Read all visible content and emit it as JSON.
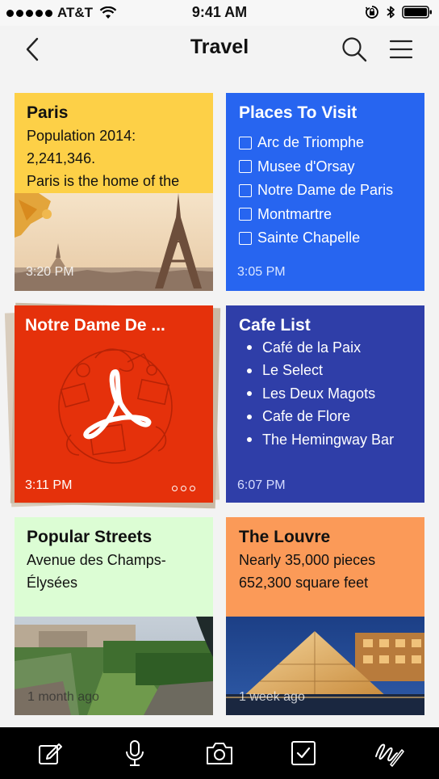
{
  "status_bar": {
    "carrier": "AT&T",
    "time": "9:41 AM",
    "icons": [
      "signal-dots",
      "wifi-icon",
      "orientation-lock-icon",
      "bluetooth-icon",
      "battery-icon"
    ]
  },
  "nav": {
    "title": "Travel",
    "back_icon": "chevron-left-icon",
    "search_icon": "search-icon",
    "menu_icon": "hamburger-menu-icon"
  },
  "cards": {
    "paris": {
      "title": "Paris",
      "body_lines": [
        "Population 2014:",
        "2,241,346.",
        "Paris is the home of the"
      ],
      "time": "3:20 PM",
      "color": "#fdd047"
    },
    "places": {
      "title": "Places To Visit",
      "items": [
        "Arc de Triomphe",
        "Musee d'Orsay",
        "Notre Dame de Paris",
        "Montmartre",
        "Sainte Chapelle"
      ],
      "time": "3:05 PM",
      "color": "#2765f0"
    },
    "notre": {
      "title": "Notre Dame De ...",
      "time": "3:11 PM",
      "icon": "pdf-icon",
      "color": "#e5310b"
    },
    "cafe": {
      "title": "Cafe List",
      "items": [
        "Café de la Paix",
        "Le Select",
        "Les Deux Magots",
        "Cafe de Flore",
        "The Hemingway Bar"
      ],
      "time": "6:07 PM",
      "color": "#2f3ea8"
    },
    "streets": {
      "title": "Popular Streets",
      "body_lines": [
        "Avenue des Champs-",
        "Élysées"
      ],
      "time": "1 month ago",
      "color": "#dcfdd4"
    },
    "louvre": {
      "title": "The Louvre",
      "body_lines": [
        "Nearly 35,000 pieces",
        "652,300 square feet"
      ],
      "time": "1 week ago",
      "color": "#fb9a58"
    }
  },
  "toolbar": {
    "icons": [
      "compose-icon",
      "microphone-icon",
      "camera-icon",
      "checkbox-icon",
      "handwriting-icon"
    ]
  }
}
